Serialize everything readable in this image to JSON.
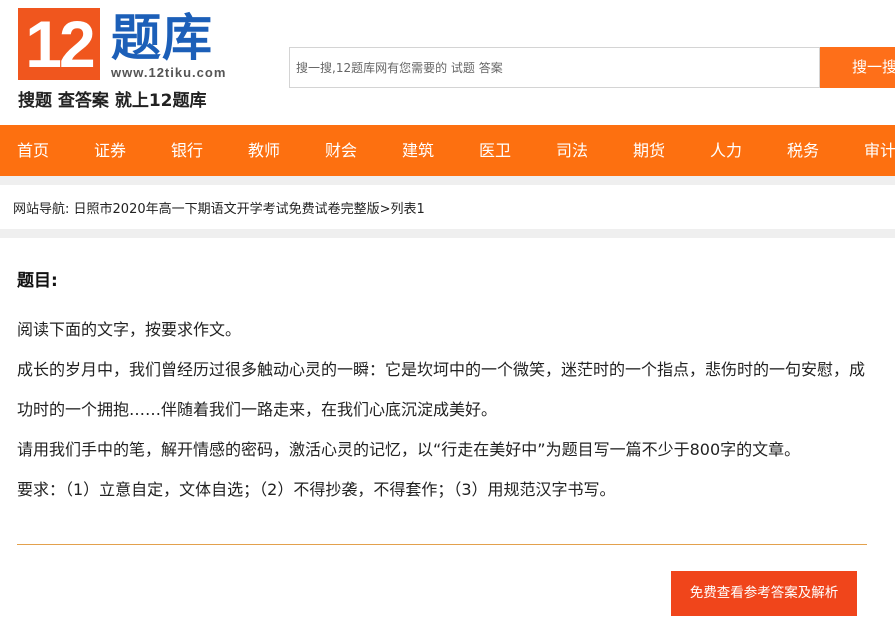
{
  "header": {
    "logo_number": "12",
    "logo_title": "题库",
    "logo_url": "www.12tiku.com",
    "slogan": "搜题 查答案 就上12题库",
    "search_placeholder": "搜一搜,12题库网有您需要的 试题 答案",
    "search_button": "搜一搜"
  },
  "nav": {
    "items": [
      "首页",
      "证券",
      "银行",
      "教师",
      "财会",
      "建筑",
      "医卫",
      "司法",
      "期货",
      "人力",
      "税务",
      "审计"
    ]
  },
  "breadcrumb": {
    "prefix": "网站导航:",
    "path": "日照市2020年高一下期语文开学考试免费试卷完整版",
    "separator": ">",
    "current": "列表1"
  },
  "question": {
    "label": "题目:",
    "paragraphs": [
      "阅读下面的文字，按要求作文。",
      "成长的岁月中，我们曾经历过很多触动心灵的一瞬：它是坎坷中的一个微笑，迷茫时的一个指点，悲伤时的一句安慰，成功时的一个拥抱……伴随着我们一路走来，在我们心底沉淀成美好。",
      "请用我们手中的笔，解开情感的密码，激活心灵的记忆，以“行走在美好中”为题目写一篇不少于800字的文章。",
      "要求：（1）立意自定，文体自选；（2）不得抄袭，不得套作；（3）用规范汉字书写。"
    ],
    "answer_button": "免费查看参考答案及解析"
  },
  "colors": {
    "brand_orange": "#fd7010",
    "logo_red": "#f0561e",
    "logo_blue": "#1c5fb8",
    "answer_button": "#f0451b",
    "divider": "#e3a14d"
  }
}
